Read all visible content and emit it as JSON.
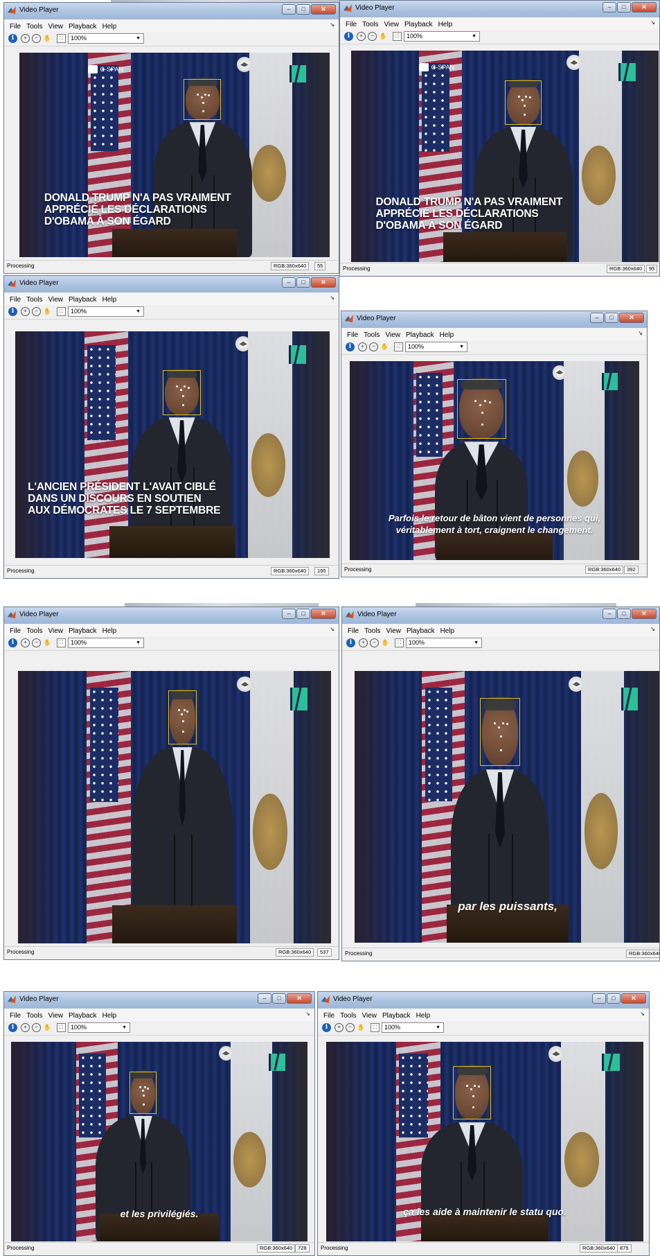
{
  "app": {
    "window_title": "Video Player",
    "menu": [
      "File",
      "Tools",
      "View",
      "Playback",
      "Help"
    ],
    "zoom": "100%",
    "status": "Processing",
    "resolution": "RGB:360x640",
    "video_labels": {
      "network_logo": "C-SPAN"
    }
  },
  "frames": [
    {
      "frame": "55",
      "caption": [
        "DONALD TRUMP N'A PAS VRAIMENT",
        "APPRÉCIÉ LES DÉCLARATIONS",
        "D'OBAMA À SON ÉGARD"
      ]
    },
    {
      "frame": "95",
      "caption": [
        "DONALD TRUMP N'A PAS VRAIMENT",
        "APPRÉCIÉ LES DÉCLARATIONS",
        "D'OBAMA À SON ÉGARD"
      ]
    },
    {
      "frame": "195",
      "caption": [
        "L'ANCIEN PRÉSIDENT L'AVAIT CIBLÉ",
        "DANS UN DISCOURS EN SOUTIEN",
        "AUX DÉMOCRATES LE 7 SEPTEMBRE"
      ]
    },
    {
      "frame": "392",
      "caption": [
        "Parfois le retour de bâton vient de personnes qui,",
        "véritablement à tort, craignent le changement."
      ]
    },
    {
      "frame": "537",
      "caption": []
    },
    {
      "frame": "",
      "caption": [
        "par les puissants,"
      ]
    },
    {
      "frame": "728",
      "caption": [
        "et les privilégiés."
      ]
    },
    {
      "frame": "875",
      "caption": [
        "ça les aide à maintenir le statu quo."
      ]
    }
  ],
  "colors": {
    "face_box": "#e6c31c",
    "brand_icon": "#2bbf9a",
    "title_gradient_top": "#c9d9ee",
    "close_button": "#c64a2e"
  },
  "icons": [
    "matlab-icon",
    "info-icon",
    "zoom-in-icon",
    "zoom-out-icon",
    "pan-hand-icon",
    "fit-to-window-icon",
    "minimize-icon",
    "maximize-icon",
    "close-icon",
    "dropdown-arrow-icon",
    "huffpost-logo-icon",
    "eagle-seal-icon",
    "cspan-camera-icon"
  ]
}
